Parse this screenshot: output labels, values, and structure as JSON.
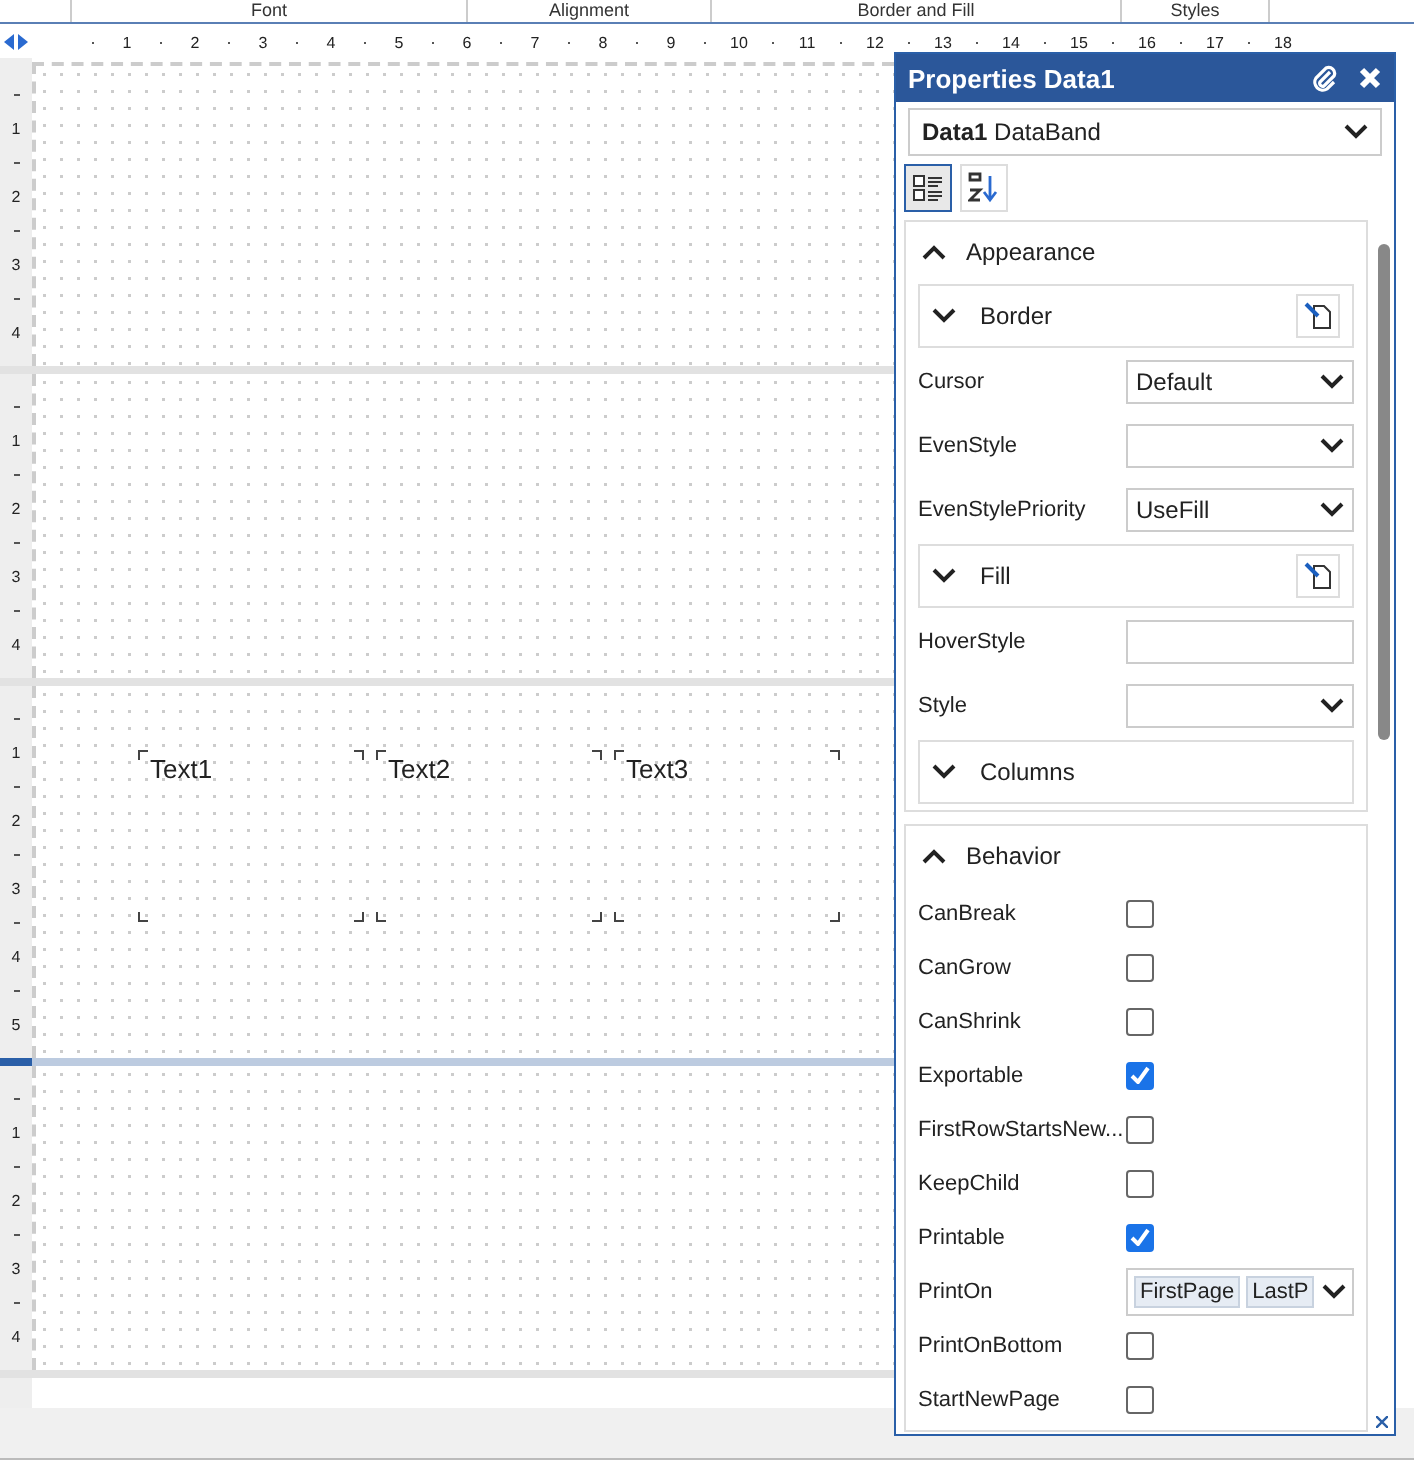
{
  "ribbon_groups": [
    "Font",
    "Alignment",
    "Border and Fill",
    "Styles"
  ],
  "ruler": {
    "numbers": [
      "1",
      "2",
      "3",
      "4",
      "5",
      "6",
      "7",
      "8",
      "9",
      "10",
      "11",
      "12",
      "13",
      "14",
      "15",
      "16",
      "17",
      "18"
    ]
  },
  "bands": [
    {
      "ruler": [
        "1",
        "2",
        "3",
        "4"
      ],
      "selected": false
    },
    {
      "ruler": [
        "1",
        "2",
        "3",
        "4"
      ],
      "selected": false
    },
    {
      "ruler": [
        "1",
        "2",
        "3",
        "4",
        "5"
      ],
      "selected": true,
      "objects": [
        {
          "text": "Text1"
        },
        {
          "text": "Text2"
        },
        {
          "text": "Text3"
        }
      ]
    },
    {
      "ruler": [
        "1",
        "2",
        "3",
        "4"
      ],
      "selected": false
    }
  ],
  "properties": {
    "title": "Properties Data1",
    "object": {
      "name": "Data1",
      "type": "DataBand"
    },
    "views": [
      {
        "kind": "categorized",
        "selected": true
      },
      {
        "kind": "alphabetical",
        "selected": false
      }
    ],
    "sections": [
      {
        "title": "Appearance",
        "expanded": true,
        "rows": [
          {
            "kind": "group",
            "label": "Border",
            "expanded": false,
            "editor": true
          },
          {
            "kind": "dropdown",
            "label": "Cursor",
            "value": "Default"
          },
          {
            "kind": "dropdown",
            "label": "EvenStyle"
          },
          {
            "kind": "dropdown",
            "label": "EvenStylePriority",
            "value": "UseFill"
          },
          {
            "kind": "group",
            "label": "Fill",
            "expanded": false,
            "editor": true
          },
          {
            "kind": "text",
            "label": "HoverStyle"
          },
          {
            "kind": "dropdown",
            "label": "Style"
          },
          {
            "kind": "group",
            "label": "Columns",
            "expanded": false,
            "editor": false
          }
        ]
      },
      {
        "title": "Behavior",
        "expanded": true,
        "rows": [
          {
            "kind": "checkbox",
            "label": "CanBreak",
            "checked": false
          },
          {
            "kind": "checkbox",
            "label": "CanGrow",
            "checked": false
          },
          {
            "kind": "checkbox",
            "label": "CanShrink",
            "checked": false
          },
          {
            "kind": "checkbox",
            "label": "Exportable",
            "checked": true
          },
          {
            "kind": "checkbox",
            "label": "FirstRowStartsNew...",
            "checked": false
          },
          {
            "kind": "checkbox",
            "label": "KeepChild",
            "checked": false
          },
          {
            "kind": "checkbox",
            "label": "Printable",
            "checked": true
          },
          {
            "kind": "tags",
            "label": "PrintOn",
            "tags": [
              "FirstPage",
              "LastP"
            ]
          },
          {
            "kind": "checkbox",
            "label": "PrintOnBottom",
            "checked": false
          },
          {
            "kind": "checkbox",
            "label": "StartNewPage",
            "checked": false
          }
        ]
      }
    ]
  }
}
